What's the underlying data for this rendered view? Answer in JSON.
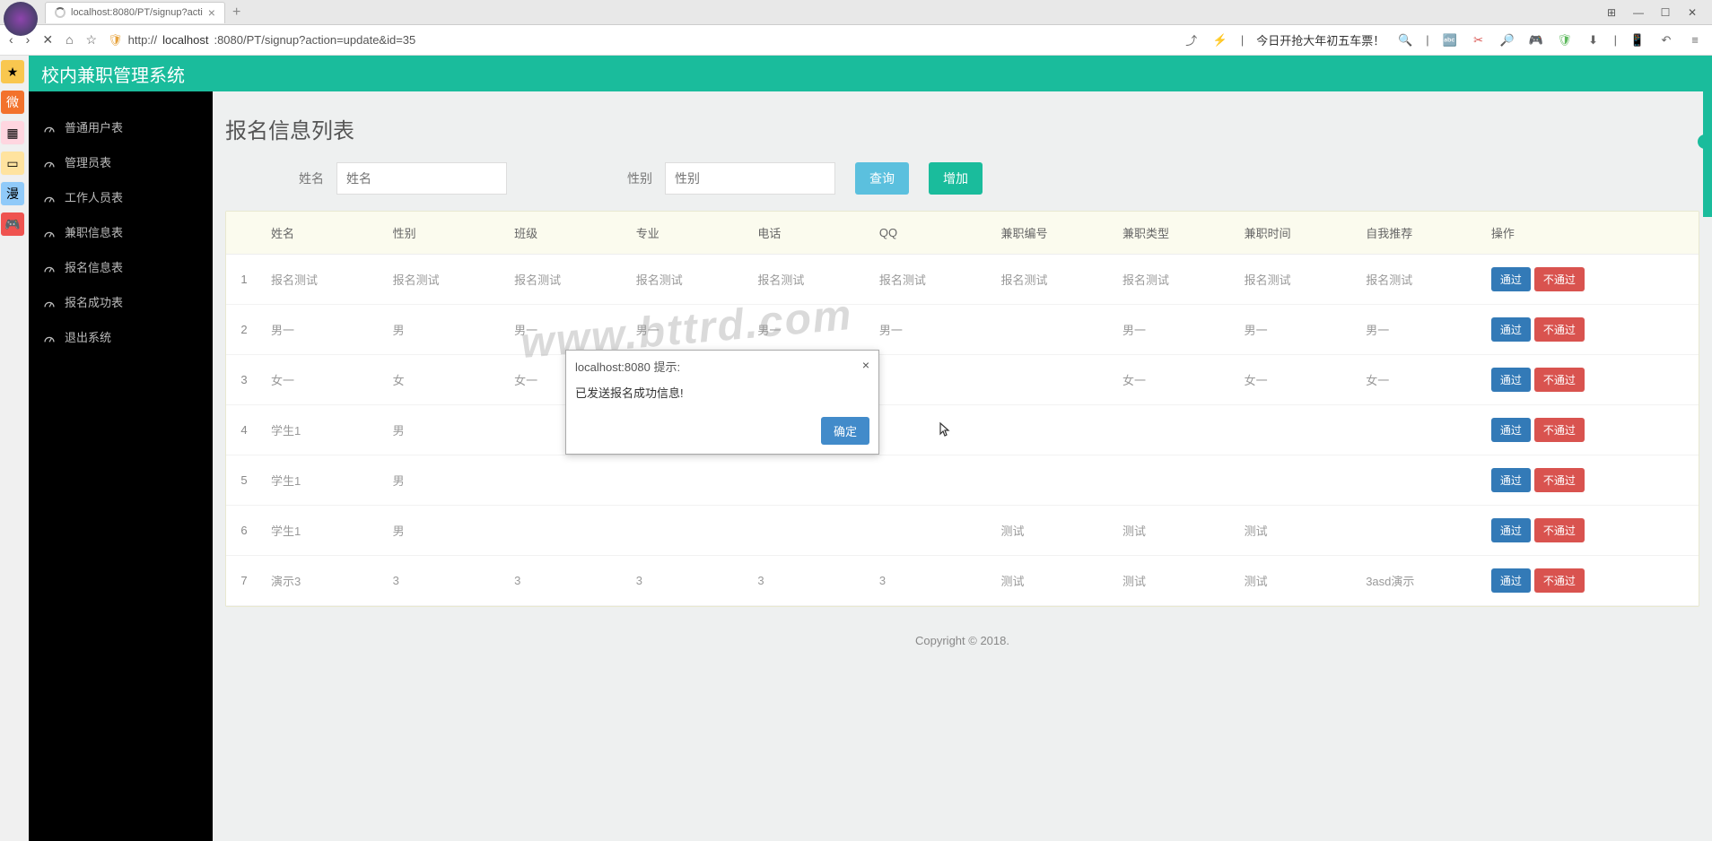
{
  "browser": {
    "tab_title": "localhost:8080/PT/signup?acti",
    "url_prefix": "http://",
    "url_host": "localhost",
    "url_rest": ":8080/PT/signup?action=update&id=35",
    "promo_text": "今日开抢大年初五车票！"
  },
  "app": {
    "title": "校内兼职管理系统"
  },
  "sidebar": {
    "items": [
      {
        "label": "普通用户表"
      },
      {
        "label": "管理员表"
      },
      {
        "label": "工作人员表"
      },
      {
        "label": "兼职信息表"
      },
      {
        "label": "报名信息表"
      },
      {
        "label": "报名成功表"
      },
      {
        "label": "退出系统"
      }
    ]
  },
  "page": {
    "title": "报名信息列表",
    "filter_name_label": "姓名",
    "filter_name_placeholder": "姓名",
    "filter_gender_label": "性别",
    "filter_gender_placeholder": "性别",
    "btn_search": "查询",
    "btn_add": "增加"
  },
  "table": {
    "headers": [
      "姓名",
      "性别",
      "班级",
      "专业",
      "电话",
      "QQ",
      "兼职编号",
      "兼职类型",
      "兼职时间",
      "自我推荐",
      "操作"
    ],
    "btn_pass": "通过",
    "btn_reject": "不通过",
    "rows": [
      {
        "idx": "1",
        "cells": [
          "报名测试",
          "报名测试",
          "报名测试",
          "报名测试",
          "报名测试",
          "报名测试",
          "报名测试",
          "报名测试",
          "报名测试",
          "报名测试"
        ]
      },
      {
        "idx": "2",
        "cells": [
          "男一",
          "男",
          "男一",
          "男一",
          "男一",
          "男一",
          "",
          "男一",
          "男一",
          "男一"
        ]
      },
      {
        "idx": "3",
        "cells": [
          "女一",
          "女",
          "女一",
          "",
          "",
          "",
          "",
          "女一",
          "女一",
          "女一"
        ]
      },
      {
        "idx": "4",
        "cells": [
          "学生1",
          "男",
          "",
          "",
          "",
          "",
          "",
          "",
          "",
          ""
        ]
      },
      {
        "idx": "5",
        "cells": [
          "学生1",
          "男",
          "",
          "",
          "",
          "",
          "",
          "",
          "",
          ""
        ]
      },
      {
        "idx": "6",
        "cells": [
          "学生1",
          "男",
          "",
          "",
          "",
          "",
          "测试",
          "测试",
          "测试",
          ""
        ]
      },
      {
        "idx": "7",
        "cells": [
          "演示3",
          "3",
          "3",
          "3",
          "3",
          "3",
          "测试",
          "测试",
          "测试",
          "3asd演示"
        ]
      }
    ]
  },
  "modal": {
    "title": "localhost:8080 提示:",
    "body": "已发送报名成功信息!",
    "ok": "确定"
  },
  "footer": {
    "text": "Copyright © 2018."
  },
  "watermark": "www.bttrd.com"
}
